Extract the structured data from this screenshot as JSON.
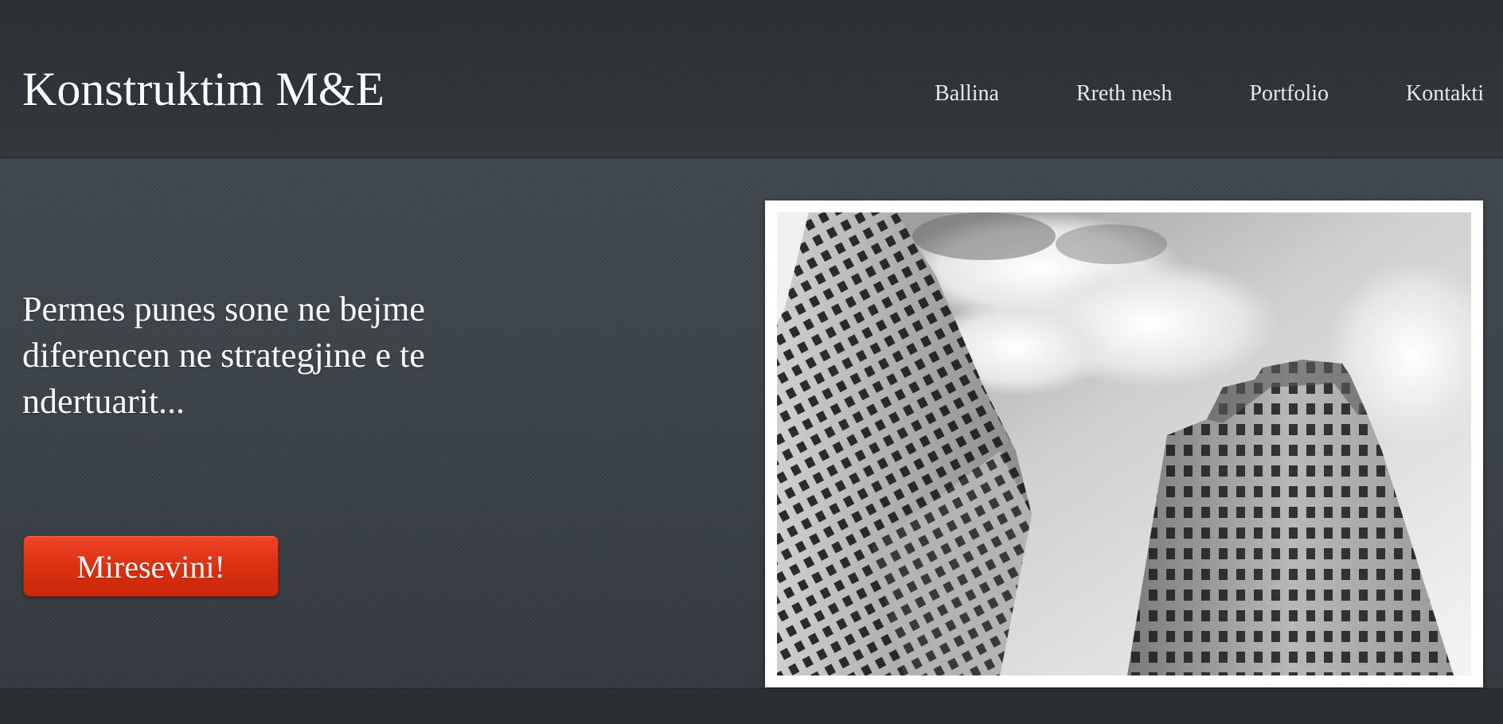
{
  "header": {
    "logo": "Konstruktim M&E"
  },
  "nav": {
    "items": [
      {
        "label": "Ballina"
      },
      {
        "label": "Rreth nesh"
      },
      {
        "label": "Portfolio"
      },
      {
        "label": "Kontakti"
      }
    ]
  },
  "hero": {
    "tagline": "Permes punes sone ne bejme diferencen ne strategjine e te ndertuarit...",
    "cta_label": "Miresevini!"
  },
  "colors": {
    "cta": "#d9300f",
    "background": "#3a4147",
    "header": "#2d3236"
  }
}
